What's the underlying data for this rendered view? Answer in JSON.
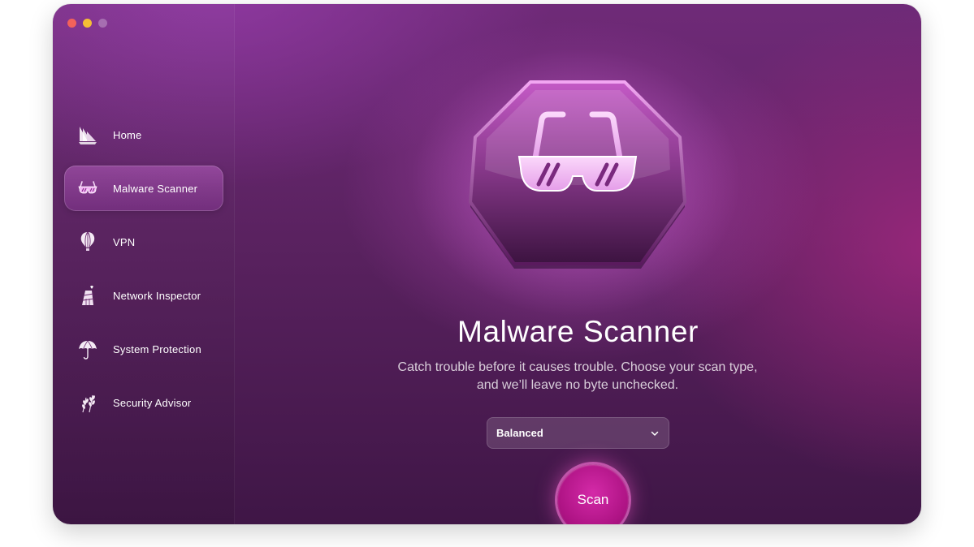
{
  "window": {
    "controls": [
      "close",
      "minimize",
      "zoom"
    ]
  },
  "sidebar": {
    "items": [
      {
        "label": "Home",
        "icon": "home-sails-icon"
      },
      {
        "label": "Malware Scanner",
        "icon": "sunglasses-icon",
        "active": true
      },
      {
        "label": "VPN",
        "icon": "hot-air-balloon-icon"
      },
      {
        "label": "Network Inspector",
        "icon": "lighthouse-icon"
      },
      {
        "label": "System Protection",
        "icon": "umbrella-icon"
      },
      {
        "label": "Security Advisor",
        "icon": "wheat-icon"
      }
    ]
  },
  "main": {
    "hero_icon": "sunglasses-badge-icon",
    "title": "Malware Scanner",
    "subtitle_line1": "Catch trouble before it causes trouble. Choose your scan type,",
    "subtitle_line2": "and we’ll leave no byte unchecked.",
    "scan_type": {
      "selected": "Balanced"
    },
    "scan_label": "Scan"
  },
  "colors": {
    "accent": "#b01486",
    "window_top": "#6f2a78",
    "window_bottom": "#3f1646",
    "active_item": "#c86ad8"
  }
}
